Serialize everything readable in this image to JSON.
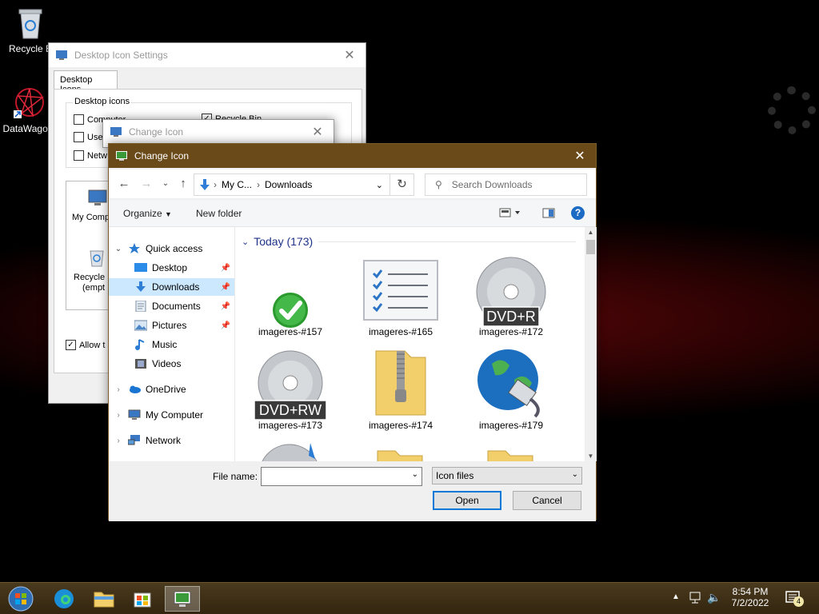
{
  "desktop": {
    "icons": [
      {
        "label": "Recycle B"
      },
      {
        "label": "DataWagon"
      }
    ]
  },
  "desktop_icon_settings": {
    "title": "Desktop Icon Settings",
    "tab": "Desktop Icons",
    "group_label": "Desktop icons",
    "checkboxes": [
      {
        "label": "Computer",
        "checked": false
      },
      {
        "label": "User",
        "checked": false
      },
      {
        "label": "Netw",
        "checked": false
      },
      {
        "label": "Recycle Bin",
        "checked": true
      }
    ],
    "preview_icons": [
      {
        "label": "My Comp"
      },
      {
        "label": "Recycle"
      },
      {
        "label": "(empt"
      }
    ],
    "allow_label": "Allow t",
    "allow_checked": true
  },
  "change_icon_back": {
    "title": "Change Icon"
  },
  "dialog": {
    "title": "Change Icon",
    "address": {
      "crumb1": "My C...",
      "crumb2": "Downloads"
    },
    "search": {
      "placeholder": "Search Downloads"
    },
    "toolbar": {
      "organize": "Organize",
      "new_folder": "New folder"
    },
    "nav": [
      {
        "label": "Quick access",
        "icon": "star-icon",
        "pinned": false
      },
      {
        "label": "Desktop",
        "icon": "desktop-icon",
        "pinned": true
      },
      {
        "label": "Downloads",
        "icon": "download-icon",
        "pinned": true,
        "selected": true
      },
      {
        "label": "Documents",
        "icon": "documents-icon",
        "pinned": true
      },
      {
        "label": "Pictures",
        "icon": "pictures-icon",
        "pinned": true
      },
      {
        "label": "Music",
        "icon": "music-icon",
        "pinned": false
      },
      {
        "label": "Videos",
        "icon": "videos-icon",
        "pinned": false
      },
      {
        "label": "OneDrive",
        "icon": "cloud-icon",
        "pinned": false
      },
      {
        "label": "My Computer",
        "icon": "computer-icon",
        "pinned": false
      },
      {
        "label": "Network",
        "icon": "network-icon",
        "pinned": false
      }
    ],
    "group": {
      "label": "Today (173)"
    },
    "files": [
      {
        "name": "imageres-#157",
        "icon": "green-check-icon"
      },
      {
        "name": "imageres-#165",
        "icon": "checklist-icon"
      },
      {
        "name": "imageres-#172",
        "icon": "dvd-r-icon",
        "badge": "DVD+R"
      },
      {
        "name": "imageres-#173",
        "icon": "dvd-rw-icon",
        "badge": "DVD+RW"
      },
      {
        "name": "imageres-#174",
        "icon": "zip-folder-icon"
      },
      {
        "name": "imageres-#179",
        "icon": "globe-network-icon"
      }
    ],
    "file_name": {
      "label": "File name:",
      "value": ""
    },
    "file_type": {
      "value": "Icon files"
    },
    "buttons": {
      "open": "Open",
      "cancel": "Cancel"
    }
  },
  "taskbar": {
    "time": "8:54 PM",
    "date": "7/2/2022",
    "notification_count": "4"
  },
  "colors": {
    "titlebar_active": "#6b4a1a",
    "selection": "#cce8ff",
    "group_header": "#1e3287",
    "accent": "#0078d7"
  }
}
